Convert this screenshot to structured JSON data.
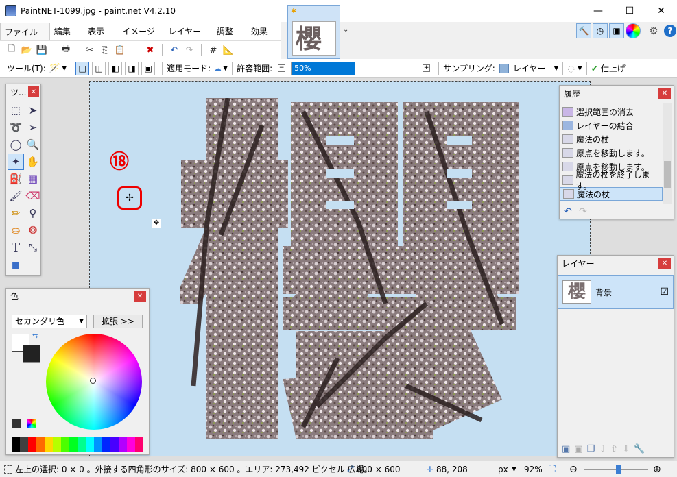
{
  "window": {
    "title": "PaintNET-1099.jpg - paint.net V4.2.10",
    "minimize": "—",
    "maximize": "☐",
    "close": "✕"
  },
  "menu": [
    "ファイル(F)",
    "編集(E)",
    "表示(V)",
    "イメージ(I)",
    "レイヤー(L)",
    "調整(A)",
    "効果(C)"
  ],
  "toolbar2": {
    "tool_label": "ツール(T):",
    "blend_label": "適用モード:",
    "tolerance_label": "許容範囲:",
    "tolerance_value": "50%",
    "tolerance_fraction": 0.5,
    "sampling_label": "サンプリング:",
    "sampling_value": "レイヤー",
    "finish_label": "仕上げ"
  },
  "tools_panel": {
    "title": "ツ..."
  },
  "history": {
    "title": "履歴",
    "items": [
      "選択範囲の消去",
      "レイヤーの結合",
      "魔法の杖",
      "原点を移動します。",
      "原点を移動します。",
      "魔法の杖を終了します。",
      "魔法の杖"
    ],
    "selected_index": 6
  },
  "layers": {
    "title": "レイヤー",
    "items": [
      {
        "name": "背景",
        "checked": "☑"
      }
    ]
  },
  "colors": {
    "title": "色",
    "dropdown": "セカンダリ色",
    "expand": "拡張 >>"
  },
  "annotation": {
    "number": "⑱"
  },
  "canvas_glyph": "櫻",
  "status": {
    "selection": "左上の選択: 0 × 0 。外接する四角形のサイズ: 800 × 600 。エリア: 273,492 ピクセル 広場。",
    "image_size": "800 × 600",
    "cursor": "88, 208",
    "unit": "px",
    "zoom": "92%"
  },
  "accent_color": "#0078d7"
}
